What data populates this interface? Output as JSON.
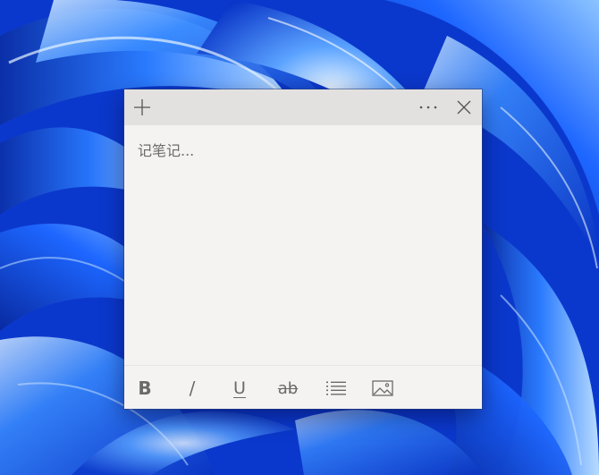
{
  "wallpaper": {
    "base_color": "#0a3ad0",
    "accent_colors": [
      "#1f6bff",
      "#7ab8ff",
      "#0a2c9e",
      "#dbeeff"
    ]
  },
  "sticky_note": {
    "titlebar": {
      "new_note_icon": "plus-icon",
      "menu_icon": "ellipsis-icon",
      "close_icon": "close-icon",
      "background": "#e2e1df"
    },
    "body": {
      "placeholder": "记笔记...",
      "value": "",
      "background": "#f4f3f1"
    },
    "toolbar": {
      "bold_label": "B",
      "italic_label": "/",
      "underline_label": "U",
      "strikethrough_label": "ab",
      "list_icon": "bulleted-list-icon",
      "image_icon": "image-icon"
    }
  }
}
